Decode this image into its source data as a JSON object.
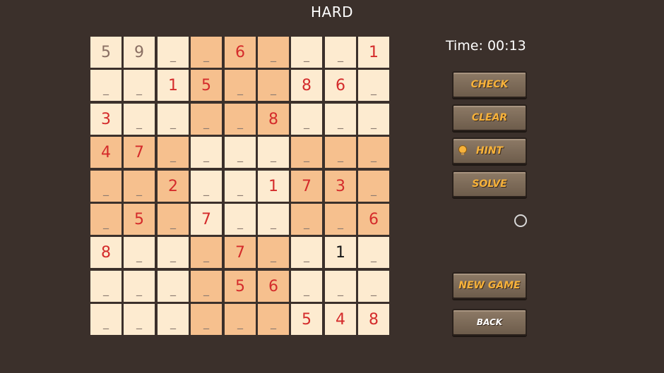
{
  "header": {
    "difficulty": "HARD"
  },
  "timer": {
    "text": "Time: 00:13"
  },
  "colors": {
    "background": "#3b302b",
    "cell_light": "#fdebd0",
    "cell_dark": "#f6c08e",
    "given_digit": "#d42b2b",
    "button_text": "#f7b23a"
  },
  "board": {
    "empty_symbol": "_",
    "rows": [
      [
        "5",
        "9",
        "",
        "",
        "6",
        "",
        "",
        "",
        "1"
      ],
      [
        "",
        "",
        "1",
        "5",
        "",
        "",
        "8",
        "6",
        ""
      ],
      [
        "3",
        "",
        "",
        "",
        "",
        "8",
        "",
        "",
        ""
      ],
      [
        "4",
        "7",
        "",
        "",
        "",
        "",
        "",
        "",
        ""
      ],
      [
        "",
        "",
        "2",
        "",
        "",
        "1",
        "7",
        "3",
        ""
      ],
      [
        "",
        "5",
        "",
        "7",
        "",
        "",
        "",
        "",
        "6"
      ],
      [
        "8",
        "",
        "",
        "",
        "7",
        "",
        "",
        "1",
        ""
      ],
      [
        "",
        "",
        "",
        "",
        "5",
        "6",
        "",
        "",
        ""
      ],
      [
        "",
        "",
        "",
        "",
        "",
        "",
        "5",
        "4",
        "8"
      ]
    ],
    "preset_cells": [
      [
        0,
        0
      ],
      [
        0,
        1
      ]
    ],
    "user_cells": [
      [
        6,
        7
      ]
    ]
  },
  "buttons": {
    "check": "CHECK",
    "clear": "CLEAR",
    "hint": "HINT",
    "solve": "SOLVE",
    "new_game": "NEW GAME",
    "back": "BACK"
  },
  "icons": {
    "hint": "lightbulb-icon",
    "cursor": "circle-cursor-icon"
  }
}
